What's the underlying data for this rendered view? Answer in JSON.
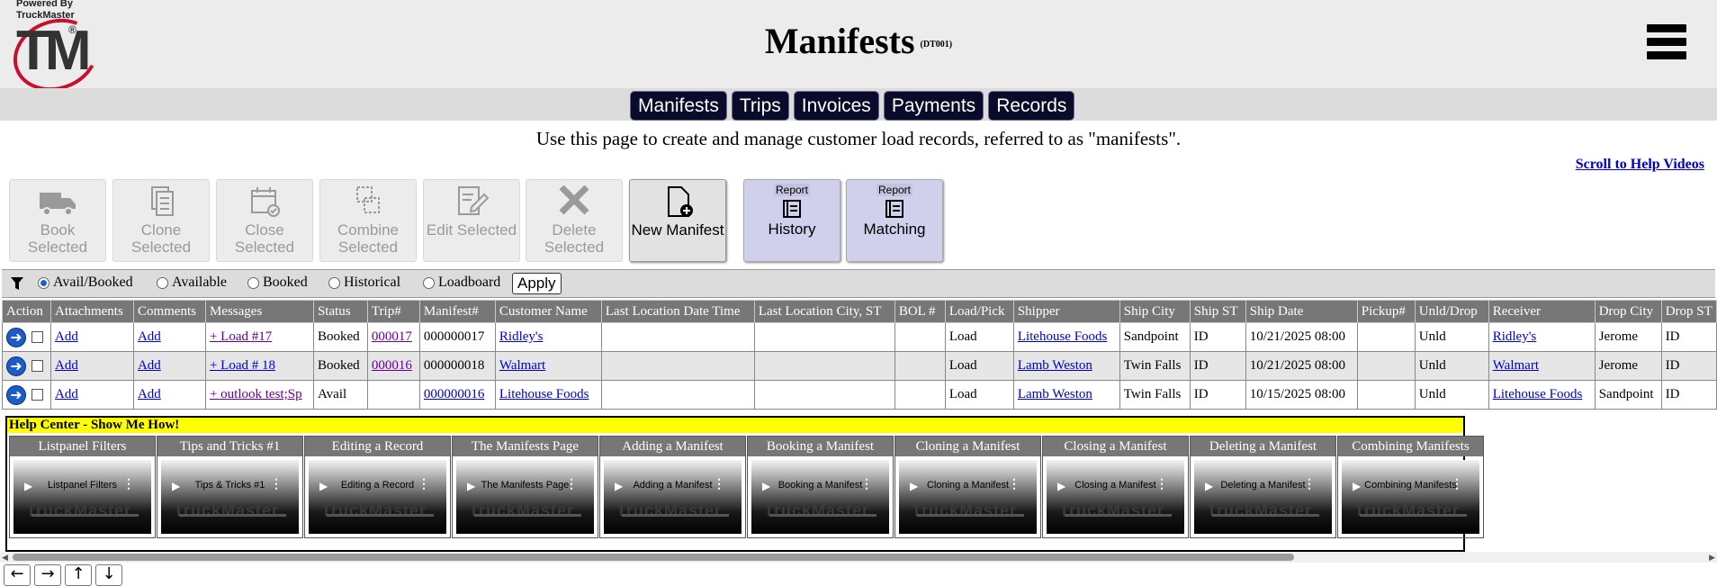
{
  "header": {
    "powered_by": "Powered By\nTruckMaster",
    "logo_text": "TM",
    "title": "Manifests",
    "code": "(DT001)"
  },
  "nav": {
    "tabs": [
      "Manifests",
      "Trips",
      "Invoices",
      "Payments",
      "Records"
    ]
  },
  "intro": "Use this page to create and manage customer load records, referred to as \"manifests\".",
  "help_link": "Scroll to Help Videos",
  "toolbar": {
    "book": "Book Selected",
    "clone": "Clone Selected",
    "close": "Close Selected",
    "combine": "Combine Selected",
    "edit": "Edit Selected",
    "delete": "Delete Selected",
    "new": "New Manifest",
    "report_tag": "Report",
    "history": "History",
    "matching": "Matching"
  },
  "filters": {
    "options": [
      "Avail/Booked",
      "Available",
      "Booked",
      "Historical",
      "Loadboard"
    ],
    "selected": "Avail/Booked",
    "apply": "Apply"
  },
  "table": {
    "headers": [
      "Action",
      "Attachments",
      "Comments",
      "Messages",
      "Status",
      "Trip#",
      "Manifest#",
      "Customer Name",
      "Last Location Date Time",
      "Last Location City, ST",
      "BOL #",
      "Load/Pick",
      "Shipper",
      "Ship City",
      "Ship ST",
      "Ship Date",
      "Pickup#",
      "Unld/Drop",
      "Receiver",
      "Drop City",
      "Drop ST"
    ],
    "rows": [
      {
        "attach": "Add",
        "comments": "Add",
        "messages": "+ Load #17",
        "status": "Booked",
        "trip": "000017",
        "manifest": "000000017",
        "customer": "Ridley's",
        "last_dt": "",
        "last_city": "",
        "bol": "",
        "load": "Load",
        "shipper": "Litehouse Foods",
        "ship_city": "Sandpoint",
        "ship_st": "ID",
        "ship_date": "10/21/2025 08:00",
        "pickup": "",
        "unld": "Unld",
        "receiver": "Ridley's",
        "drop_city": "Jerome",
        "drop_st": "ID"
      },
      {
        "attach": "Add",
        "comments": "Add",
        "messages": "+ Load # 18",
        "status": "Booked",
        "trip": "000016",
        "manifest": "000000018",
        "customer": "Walmart",
        "last_dt": "",
        "last_city": "",
        "bol": "",
        "load": "Load",
        "shipper": "Lamb Weston",
        "ship_city": "Twin Falls",
        "ship_st": "ID",
        "ship_date": "10/21/2025 08:00",
        "pickup": "",
        "unld": "Unld",
        "receiver": "Walmart",
        "drop_city": "Jerome",
        "drop_st": "ID"
      },
      {
        "attach": "Add",
        "comments": "Add",
        "messages": "+ outlook test;Sp",
        "status": "Avail",
        "trip": "",
        "manifest": "000000016",
        "customer": "Litehouse Foods",
        "last_dt": "",
        "last_city": "",
        "bol": "",
        "load": "Load",
        "shipper": "Lamb Weston",
        "ship_city": "Twin Falls",
        "ship_st": "ID",
        "ship_date": "10/15/2025 08:00",
        "pickup": "",
        "unld": "Unld",
        "receiver": "Litehouse Foods",
        "drop_city": "Sandpoint",
        "drop_st": "ID"
      }
    ]
  },
  "help_center": {
    "title": "Help Center - Show Me How!",
    "videos": [
      {
        "heading": "Listpanel Filters",
        "thumb": "Listpanel Filters"
      },
      {
        "heading": "Tips and Tricks #1",
        "thumb": "Tips & Tricks #1"
      },
      {
        "heading": "Editing a Record",
        "thumb": "Editing a Record"
      },
      {
        "heading": "The Manifests Page",
        "thumb": "The Manifests Page"
      },
      {
        "heading": "Adding a Manifest",
        "thumb": "Adding a Manifest"
      },
      {
        "heading": "Booking a Manifest",
        "thumb": "Booking a Manifest"
      },
      {
        "heading": "Cloning a Manifest",
        "thumb": "Cloning a Manifest"
      },
      {
        "heading": "Closing a Manifest",
        "thumb": "Closing a Manifest"
      },
      {
        "heading": "Deleting a Manifest",
        "thumb": "Deleting a Manifest"
      },
      {
        "heading": "Combining Manifests",
        "thumb": "Combining Manifests"
      }
    ],
    "thumb_brand": "TruckMaster"
  },
  "arrows": [
    "←",
    "→",
    "↑",
    "↓"
  ],
  "colors": {
    "header_bg": "#ececec",
    "nav_tab": "#0a0a2a",
    "table_head": "#777777",
    "link": "#0000cc",
    "visited": "#660099",
    "help_banner": "#ffff00",
    "report_btn": "#d0d0ec"
  }
}
